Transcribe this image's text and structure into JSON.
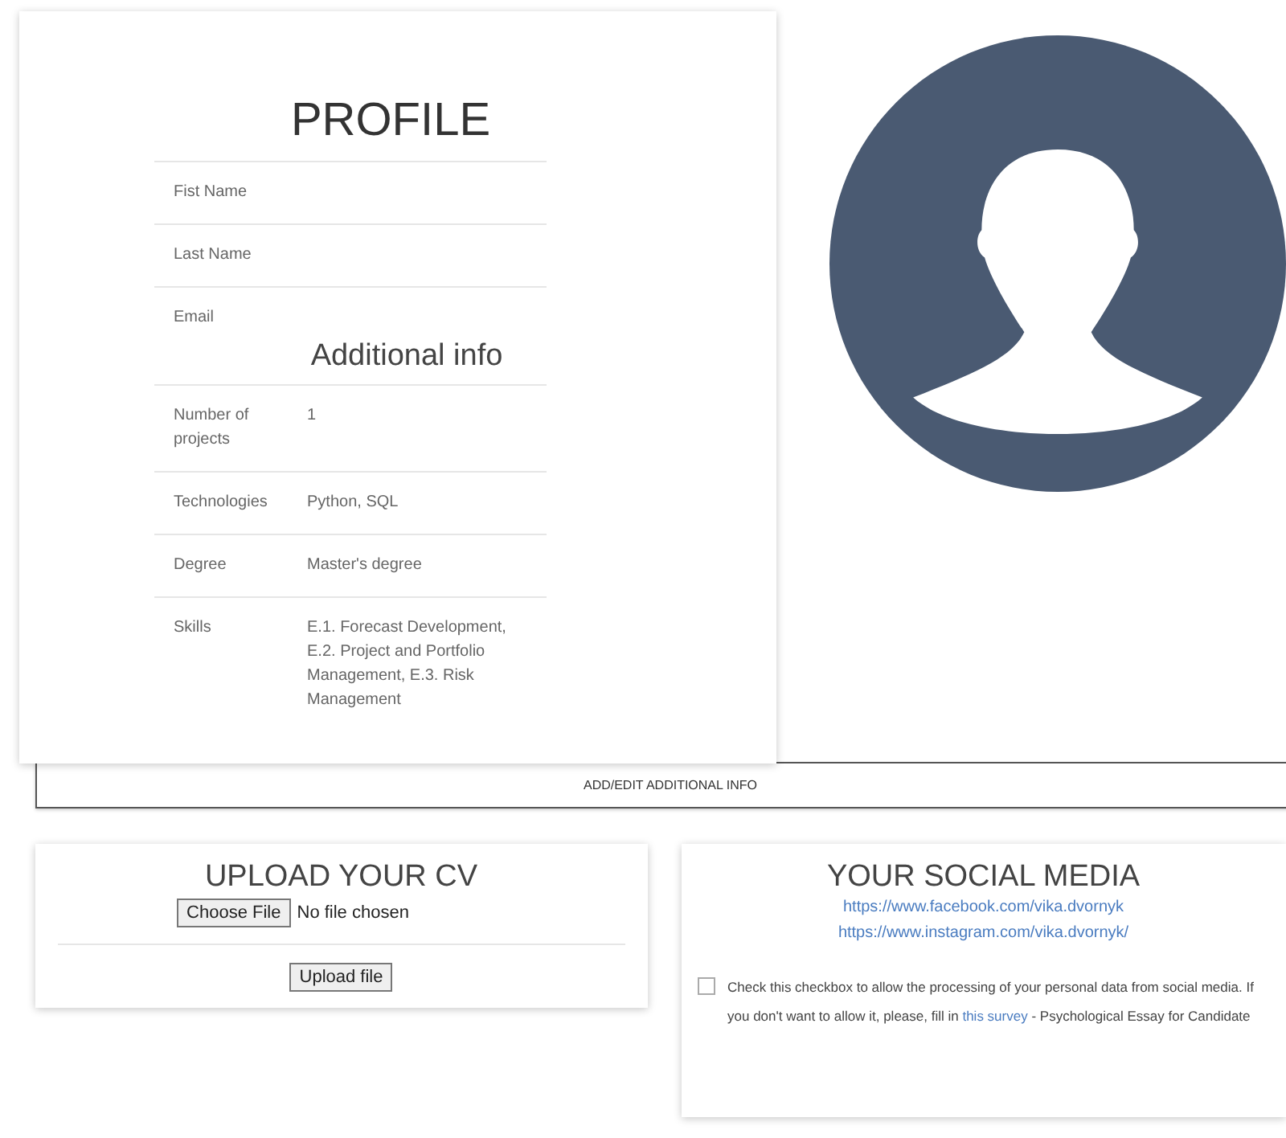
{
  "profile": {
    "title": "PROFILE",
    "fields": [
      {
        "label": "Fist Name"
      },
      {
        "label": "Last Name"
      },
      {
        "label": "Email"
      }
    ],
    "additional_title": "Additional info",
    "additional": [
      {
        "label": "Number of projects",
        "value": "1"
      },
      {
        "label": "Technologies",
        "value": "Python, SQL"
      },
      {
        "label": "Degree",
        "value": "Master's degree"
      },
      {
        "label": "Skills",
        "value": "E.1. Forecast Development, E.2. Project and Portfolio Management, E.3. Risk Management"
      }
    ]
  },
  "add_button": "ADD/EDIT ADDITIONAL INFO",
  "upload": {
    "title": "UPLOAD YOUR CV",
    "choose_button": "Choose File",
    "file_status": "No file chosen",
    "upload_button": "Upload file"
  },
  "social": {
    "title": "YOUR SOCIAL MEDIA",
    "links": [
      "https://www.facebook.com/vika.dvornyk",
      "https://www.instagram.com/vika.dvornyk/"
    ],
    "consent": {
      "checked": false,
      "text_before": "Check this checkbox to allow the processing of your personal data from social media. If you don't want to allow it, please, fill in",
      "link": "this survey",
      "text_after": "- Psychological Essay for Candidate"
    }
  }
}
